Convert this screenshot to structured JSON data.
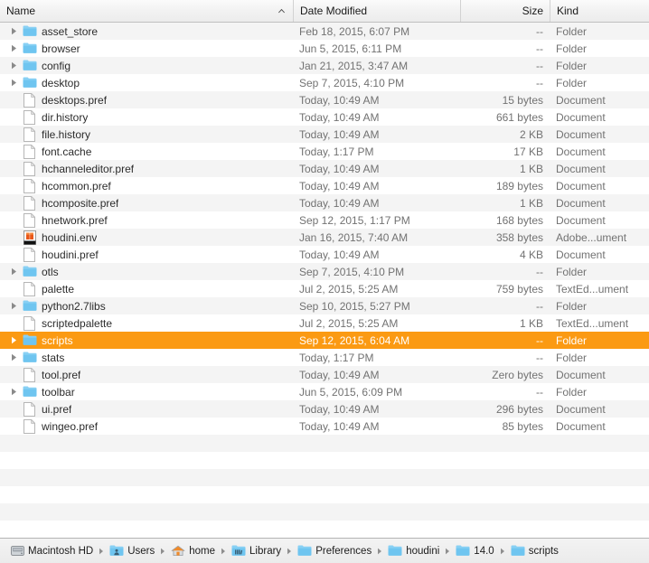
{
  "columns": {
    "name": "Name",
    "date_modified": "Date Modified",
    "size": "Size",
    "kind": "Kind",
    "sort_indicator": "chevron-up-icon"
  },
  "colors": {
    "selection": "#fb9a13",
    "folder_icon": "#6fc5f0",
    "stripe": "#f4f4f4",
    "header_text": "#1a1a1a",
    "secondary_text": "#727272"
  },
  "files": [
    {
      "name": "asset_store",
      "date": "Feb 18, 2015, 6:07 PM",
      "size": "--",
      "kind": "Folder",
      "icon": "folder-icon",
      "expandable": true,
      "selected": false
    },
    {
      "name": "browser",
      "date": "Jun 5, 2015, 6:11 PM",
      "size": "--",
      "kind": "Folder",
      "icon": "folder-icon",
      "expandable": true,
      "selected": false
    },
    {
      "name": "config",
      "date": "Jan 21, 2015, 3:47 AM",
      "size": "--",
      "kind": "Folder",
      "icon": "folder-icon",
      "expandable": true,
      "selected": false
    },
    {
      "name": "desktop",
      "date": "Sep 7, 2015, 4:10 PM",
      "size": "--",
      "kind": "Folder",
      "icon": "folder-icon",
      "expandable": true,
      "selected": false
    },
    {
      "name": "desktops.pref",
      "date": "Today, 10:49 AM",
      "size": "15 bytes",
      "kind": "Document",
      "icon": "document-icon",
      "expandable": false,
      "selected": false
    },
    {
      "name": "dir.history",
      "date": "Today, 10:49 AM",
      "size": "661 bytes",
      "kind": "Document",
      "icon": "document-icon",
      "expandable": false,
      "selected": false
    },
    {
      "name": "file.history",
      "date": "Today, 10:49 AM",
      "size": "2 KB",
      "kind": "Document",
      "icon": "document-icon",
      "expandable": false,
      "selected": false
    },
    {
      "name": "font.cache",
      "date": "Today, 1:17 PM",
      "size": "17 KB",
      "kind": "Document",
      "icon": "document-icon",
      "expandable": false,
      "selected": false
    },
    {
      "name": "hchanneleditor.pref",
      "date": "Today, 10:49 AM",
      "size": "1 KB",
      "kind": "Document",
      "icon": "document-icon",
      "expandable": false,
      "selected": false
    },
    {
      "name": "hcommon.pref",
      "date": "Today, 10:49 AM",
      "size": "189 bytes",
      "kind": "Document",
      "icon": "document-icon",
      "expandable": false,
      "selected": false
    },
    {
      "name": "hcomposite.pref",
      "date": "Today, 10:49 AM",
      "size": "1 KB",
      "kind": "Document",
      "icon": "document-icon",
      "expandable": false,
      "selected": false
    },
    {
      "name": "hnetwork.pref",
      "date": "Sep 12, 2015, 1:17 PM",
      "size": "168 bytes",
      "kind": "Document",
      "icon": "document-icon",
      "expandable": false,
      "selected": false
    },
    {
      "name": "houdini.env",
      "date": "Jan 16, 2015, 7:40 AM",
      "size": "358 bytes",
      "kind": "Adobe...ument",
      "icon": "adobe-document-icon",
      "expandable": false,
      "selected": false
    },
    {
      "name": "houdini.pref",
      "date": "Today, 10:49 AM",
      "size": "4 KB",
      "kind": "Document",
      "icon": "document-icon",
      "expandable": false,
      "selected": false
    },
    {
      "name": "otls",
      "date": "Sep 7, 2015, 4:10 PM",
      "size": "--",
      "kind": "Folder",
      "icon": "folder-icon",
      "expandable": true,
      "selected": false
    },
    {
      "name": "palette",
      "date": "Jul 2, 2015, 5:25 AM",
      "size": "759 bytes",
      "kind": "TextEd...ument",
      "icon": "document-icon",
      "expandable": false,
      "selected": false
    },
    {
      "name": "python2.7libs",
      "date": "Sep 10, 2015, 5:27 PM",
      "size": "--",
      "kind": "Folder",
      "icon": "folder-icon",
      "expandable": true,
      "selected": false
    },
    {
      "name": "scriptedpalette",
      "date": "Jul 2, 2015, 5:25 AM",
      "size": "1 KB",
      "kind": "TextEd...ument",
      "icon": "document-icon",
      "expandable": false,
      "selected": false
    },
    {
      "name": "scripts",
      "date": "Sep 12, 2015, 6:04 AM",
      "size": "--",
      "kind": "Folder",
      "icon": "folder-icon",
      "expandable": true,
      "selected": true
    },
    {
      "name": "stats",
      "date": "Today, 1:17 PM",
      "size": "--",
      "kind": "Folder",
      "icon": "folder-icon",
      "expandable": true,
      "selected": false
    },
    {
      "name": "tool.pref",
      "date": "Today, 10:49 AM",
      "size": "Zero bytes",
      "kind": "Document",
      "icon": "document-icon",
      "expandable": false,
      "selected": false
    },
    {
      "name": "toolbar",
      "date": "Jun 5, 2015, 6:09 PM",
      "size": "--",
      "kind": "Folder",
      "icon": "folder-icon",
      "expandable": true,
      "selected": false
    },
    {
      "name": "ui.pref",
      "date": "Today, 10:49 AM",
      "size": "296 bytes",
      "kind": "Document",
      "icon": "document-icon",
      "expandable": false,
      "selected": false
    },
    {
      "name": "wingeo.pref",
      "date": "Today, 10:49 AM",
      "size": "85 bytes",
      "kind": "Document",
      "icon": "document-icon",
      "expandable": false,
      "selected": false
    }
  ],
  "path_bar": {
    "crumbs": [
      {
        "label": "Macintosh HD",
        "icon": "harddisk-icon"
      },
      {
        "label": "Users",
        "icon": "users-folder-icon"
      },
      {
        "label": "home",
        "icon": "home-folder-icon"
      },
      {
        "label": "Library",
        "icon": "library-folder-icon"
      },
      {
        "label": "Preferences",
        "icon": "folder-icon"
      },
      {
        "label": "houdini",
        "icon": "folder-icon"
      },
      {
        "label": "14.0",
        "icon": "folder-icon"
      },
      {
        "label": "scripts",
        "icon": "folder-icon"
      }
    ],
    "separator": "chevron-right-icon"
  }
}
